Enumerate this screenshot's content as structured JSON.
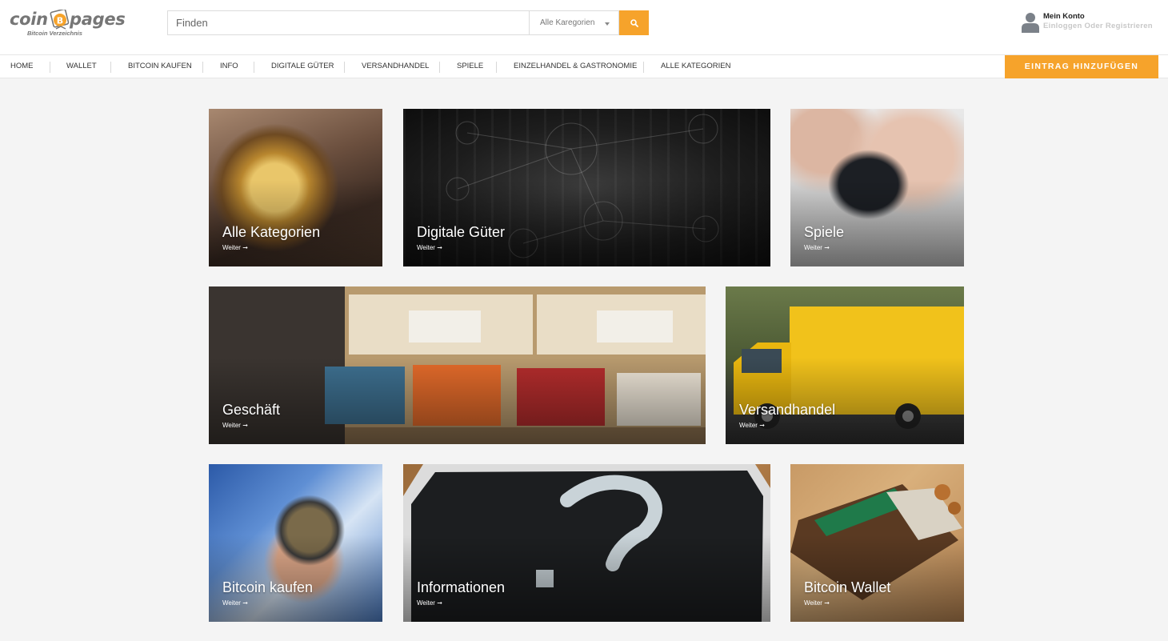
{
  "logo": {
    "word_left": "coin",
    "word_right": "pages",
    "tagline": "Bitcoin Verzeichnis"
  },
  "search": {
    "placeholder": "Finden",
    "category_selected": "Alle Karegorien"
  },
  "account": {
    "title": "Mein Konto",
    "subtitle": "Einloggen Oder Registrieren"
  },
  "nav": {
    "items": [
      "HOME",
      "WALLET",
      "BITCOIN KAUFEN",
      "INFO",
      "DIGITALE GÜTER",
      "VERSANDHANDEL",
      "SPIELE",
      "EINZELHANDEL & GASTRONOMIE",
      "ALLE KATEGORIEN"
    ],
    "add_button": "EINTRAG HINZUFÜGEN"
  },
  "tiles": [
    {
      "title": "Alle Kategorien",
      "more": "Weiter ➞"
    },
    {
      "title": "Digitale Güter",
      "more": "Weiter ➞"
    },
    {
      "title": "Spiele",
      "more": "Weiter ➞"
    },
    {
      "title": "Geschäft",
      "more": "Weiter ➞"
    },
    {
      "title": "Versandhandel",
      "more": "Weiter ➞"
    },
    {
      "title": "Bitcoin kaufen",
      "more": "Weiter ➞"
    },
    {
      "title": "Informationen",
      "more": "Weiter ➞"
    },
    {
      "title": "Bitcoin Wallet",
      "more": "Weiter ➞"
    }
  ],
  "colors": {
    "accent": "#f6a32b",
    "logo_gray": "#767676",
    "background": "#f4f4f4"
  },
  "icons": {
    "search": "search-icon",
    "account": "user-icon",
    "caret": "caret-down-icon",
    "logo_coin": "bitcoin-coin-icon"
  }
}
